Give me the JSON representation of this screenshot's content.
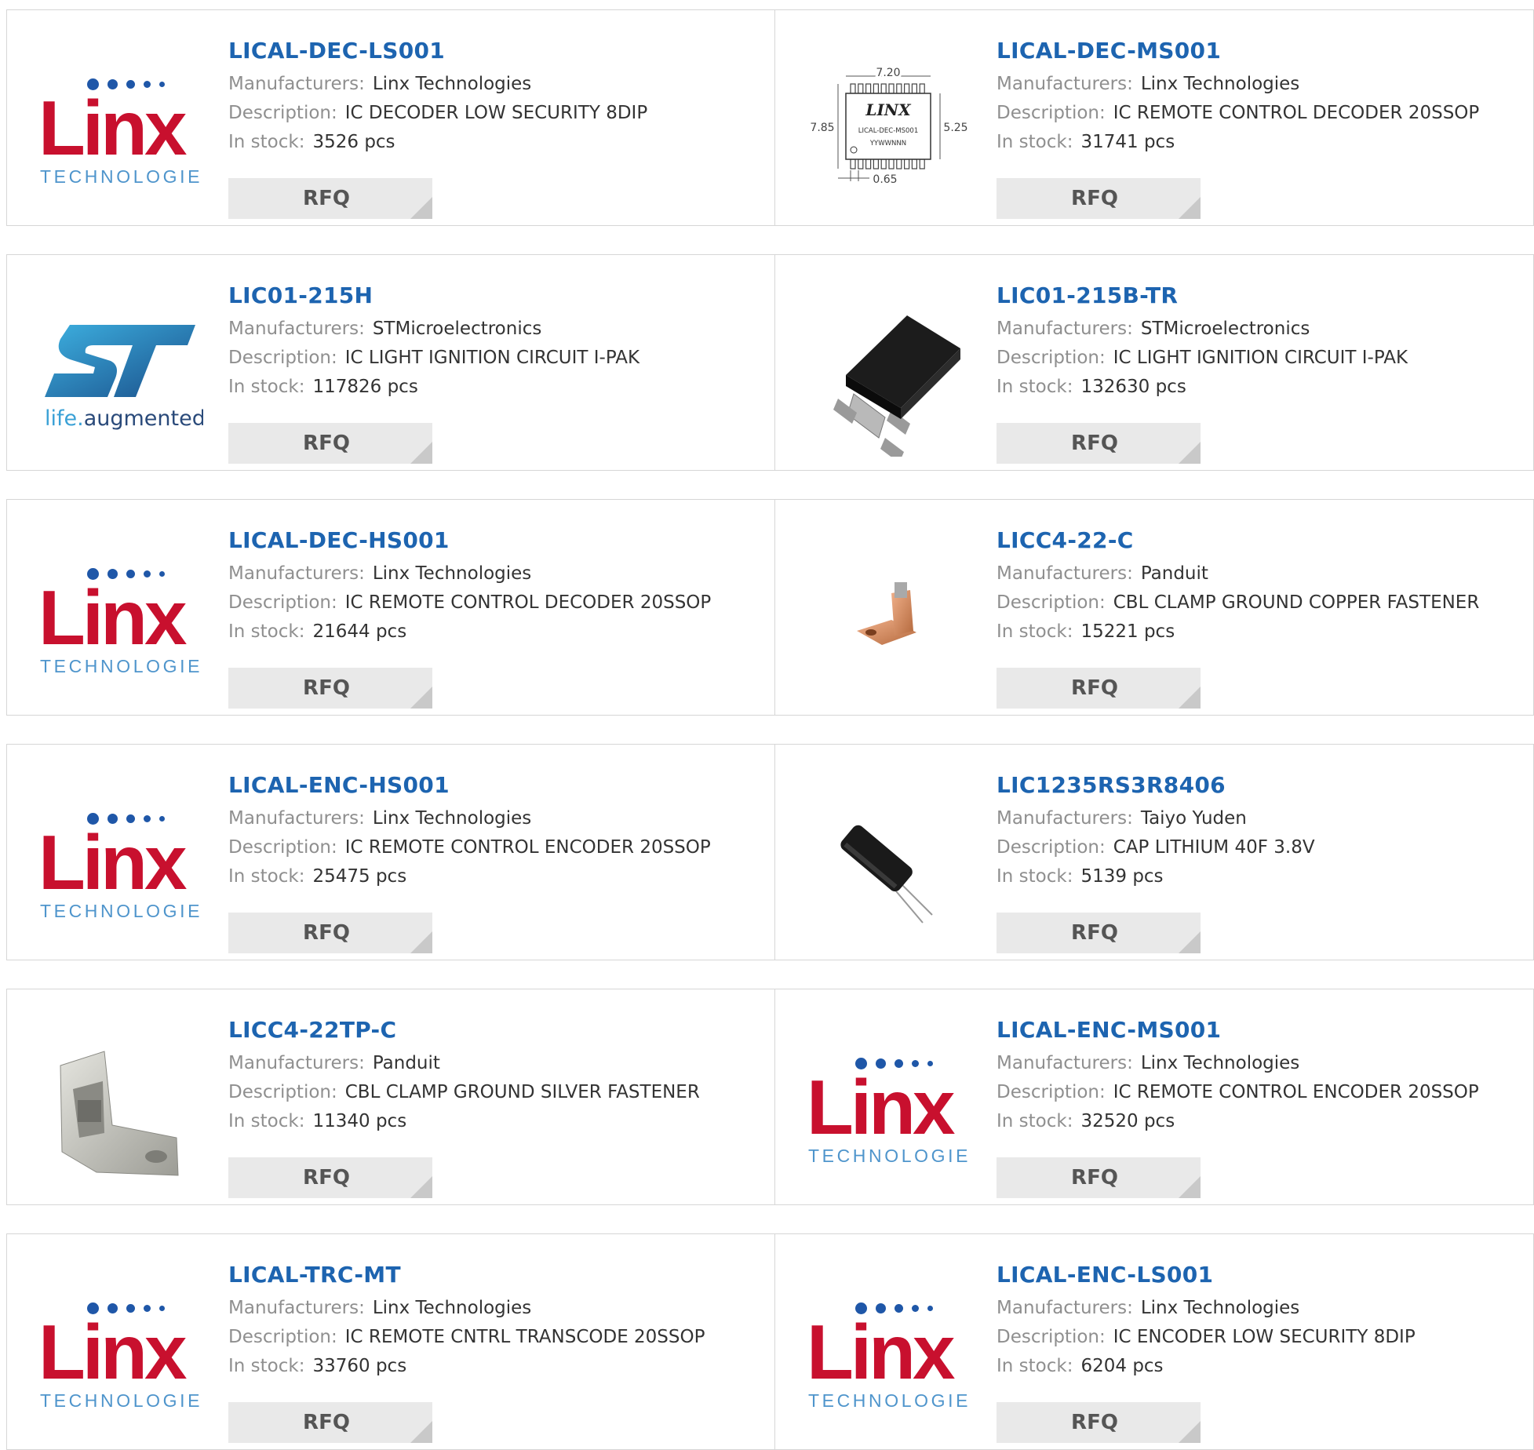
{
  "labels": {
    "manufacturer": "Manufacturers:",
    "description": "Description:",
    "stock": "In stock:",
    "rfq": "RFQ"
  },
  "brands": {
    "linx": {
      "word": "Linx",
      "sub": "TECHNOLOGIES"
    },
    "st": {
      "tag_life": "life.",
      "tag_rest": "augmented"
    }
  },
  "colors": {
    "part_link": "#1d64b0",
    "label_gray": "#8f8f8f",
    "value_text": "#333333",
    "rfq_bg": "#e9e9e9",
    "linx_red": "#c8102e",
    "linx_blue": "#1f57a8",
    "st_blue": "#3aa1d6"
  },
  "products": [
    {
      "part": "LICAL-DEC-LS001",
      "manufacturer": "Linx Technologies",
      "description": "IC DECODER LOW SECURITY 8DIP",
      "stock": "3526 pcs",
      "image": "linx-logo"
    },
    {
      "part": "LICAL-DEC-MS001",
      "manufacturer": "Linx Technologies",
      "description": "IC REMOTE CONTROL DECODER 20SSOP",
      "stock": "31741 pcs",
      "image": "ssop-drawing",
      "drawing": {
        "top": "7.20",
        "left": "7.85",
        "right": "5.25",
        "bottom": "0.65",
        "chip_logo": "LINX",
        "chip_part": "LICAL-DEC-MS001",
        "chip_code": "YYWWNNN"
      }
    },
    {
      "part": "LIC01-215H",
      "manufacturer": "STMicroelectronics",
      "description": "IC LIGHT IGNITION CIRCUIT I-PAK",
      "stock": "117826 pcs",
      "image": "st-logo"
    },
    {
      "part": "LIC01-215B-TR",
      "manufacturer": "STMicroelectronics",
      "description": "IC LIGHT IGNITION CIRCUIT I-PAK",
      "stock": "132630 pcs",
      "image": "dpak-photo"
    },
    {
      "part": "LICAL-DEC-HS001",
      "manufacturer": "Linx Technologies",
      "description": "IC REMOTE CONTROL DECODER 20SSOP",
      "stock": "21644 pcs",
      "image": "linx-logo"
    },
    {
      "part": "LICC4-22-C",
      "manufacturer": "Panduit",
      "description": "CBL CLAMP GROUND COPPER FASTENER",
      "stock": "15221 pcs",
      "image": "copper-clamp-photo"
    },
    {
      "part": "LICAL-ENC-HS001",
      "manufacturer": "Linx Technologies",
      "description": "IC REMOTE CONTROL ENCODER 20SSOP",
      "stock": "25475 pcs",
      "image": "linx-logo"
    },
    {
      "part": "LIC1235RS3R8406",
      "manufacturer": "Taiyo Yuden",
      "description": "CAP LITHIUM 40F 3.8V",
      "stock": "5139 pcs",
      "image": "capacitor-photo"
    },
    {
      "part": "LICC4-22TP-C",
      "manufacturer": "Panduit",
      "description": "CBL CLAMP GROUND SILVER FASTENER",
      "stock": "11340 pcs",
      "image": "silver-clamp-photo"
    },
    {
      "part": "LICAL-ENC-MS001",
      "manufacturer": "Linx Technologies",
      "description": "IC REMOTE CONTROL ENCODER 20SSOP",
      "stock": "32520 pcs",
      "image": "linx-logo"
    },
    {
      "part": "LICAL-TRC-MT",
      "manufacturer": "Linx Technologies",
      "description": "IC REMOTE CNTRL TRANSCODE 20SSOP",
      "stock": "33760 pcs",
      "image": "linx-logo"
    },
    {
      "part": "LICAL-ENC-LS001",
      "manufacturer": "Linx Technologies",
      "description": "IC ENCODER LOW SECURITY 8DIP",
      "stock": "6204 pcs",
      "image": "linx-logo"
    }
  ]
}
